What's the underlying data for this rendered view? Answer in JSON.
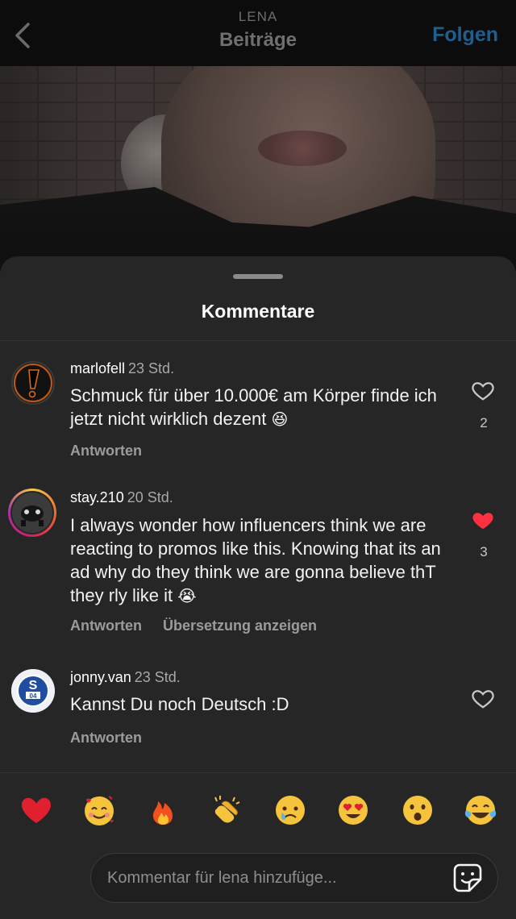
{
  "nav": {
    "username": "LENA",
    "page_title": "Beiträge",
    "follow_label": "Folgen"
  },
  "sheet": {
    "title": "Kommentare"
  },
  "comments": [
    {
      "user": "marlofell",
      "time": "23 Std.",
      "text": "Schmuck für über 10.000€ am Körper finde ich jetzt nicht wirklich dezent",
      "emoji": "😆",
      "likes": "2",
      "liked": false,
      "actions": [
        "Antworten"
      ]
    },
    {
      "user": "stay.210",
      "time": "20 Std.",
      "text": "I always wonder how influencers think we are reacting to promos like this. Knowing that its an ad why do they think we are gonna believe thT they rly like it",
      "emoji": "😭",
      "likes": "3",
      "liked": true,
      "actions": [
        "Antworten",
        "Übersetzung anzeigen"
      ]
    },
    {
      "user": "jonny.van",
      "time": "23 Std.",
      "text": "Kannst Du noch Deutsch :D",
      "emoji": "",
      "likes": "",
      "liked": false,
      "actions": [
        "Antworten"
      ]
    }
  ],
  "quick_reactions": [
    "red-heart",
    "smiling-face-with-hearts",
    "fire",
    "clapping-hands",
    "crying-face",
    "heart-eyes",
    "open-mouth-face",
    "tears-of-joy"
  ],
  "composer": {
    "placeholder": "Kommentar für lena hinzufüge..."
  },
  "colors": {
    "like_active": "#ff3040",
    "follow": "#0095f6",
    "sheet_bg": "#262626"
  }
}
